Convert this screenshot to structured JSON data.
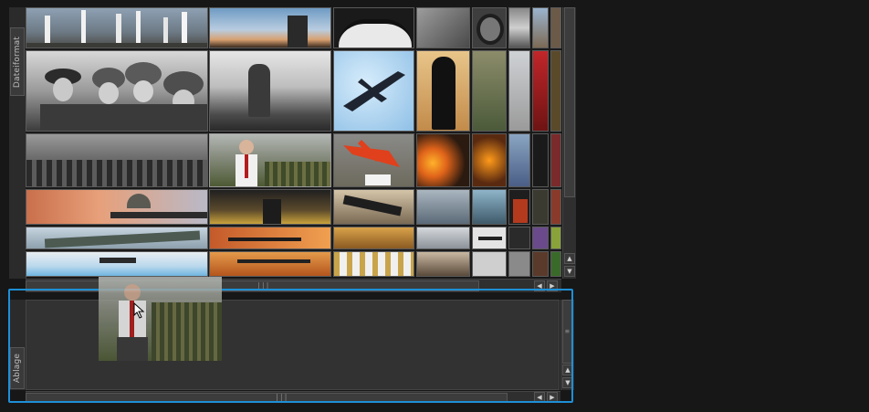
{
  "tabs": {
    "dateiformat": "Dateiformat",
    "ablage": "Ablage"
  },
  "grid": {
    "tiles": [
      {
        "name": "rocket-launch"
      },
      {
        "name": "sky-horizon"
      },
      {
        "name": "helmet-closeup"
      },
      {
        "name": "soldier-bw"
      },
      {
        "name": "tire"
      },
      {
        "name": "missile-silo"
      },
      {
        "name": "strip-1"
      },
      {
        "name": "officers-bw"
      },
      {
        "name": "soldier-hill"
      },
      {
        "name": "cruise-missile"
      },
      {
        "name": "soldier-silhouette"
      },
      {
        "name": "soldier-grass"
      },
      {
        "name": "helicopter-small"
      },
      {
        "name": "red-strip"
      },
      {
        "name": "troops-formation"
      },
      {
        "name": "president-speech"
      },
      {
        "name": "slam-missile"
      },
      {
        "name": "explosions"
      },
      {
        "name": "fire-soldiers"
      },
      {
        "name": "astronaut"
      },
      {
        "name": "dark-figure"
      },
      {
        "name": "sniper"
      },
      {
        "name": "tornado"
      },
      {
        "name": "machine-gunner"
      },
      {
        "name": "aircraft-carrier"
      },
      {
        "name": "gas-mask"
      },
      {
        "name": "dynamite"
      },
      {
        "name": "last-col"
      },
      {
        "name": "missile-launcher"
      },
      {
        "name": "rifle-sunset"
      },
      {
        "name": "desert-troops"
      },
      {
        "name": "clouds"
      },
      {
        "name": "jet"
      },
      {
        "name": "misc1"
      },
      {
        "name": "misc2"
      },
      {
        "name": "helicopter-sky"
      },
      {
        "name": "helicopter-orange"
      },
      {
        "name": "bullets"
      },
      {
        "name": "ship-dusk"
      },
      {
        "name": "misc3"
      },
      {
        "name": "misc4"
      },
      {
        "name": "misc5"
      }
    ]
  },
  "colors": {
    "accent": "#1f8fd6",
    "panel": "#323232",
    "background": "#171717"
  },
  "icons": {
    "scroll_up": "▲",
    "scroll_down": "▼",
    "scroll_left": "◀",
    "scroll_right": "▶",
    "grip_v": "≡",
    "grip_h": "|||"
  }
}
